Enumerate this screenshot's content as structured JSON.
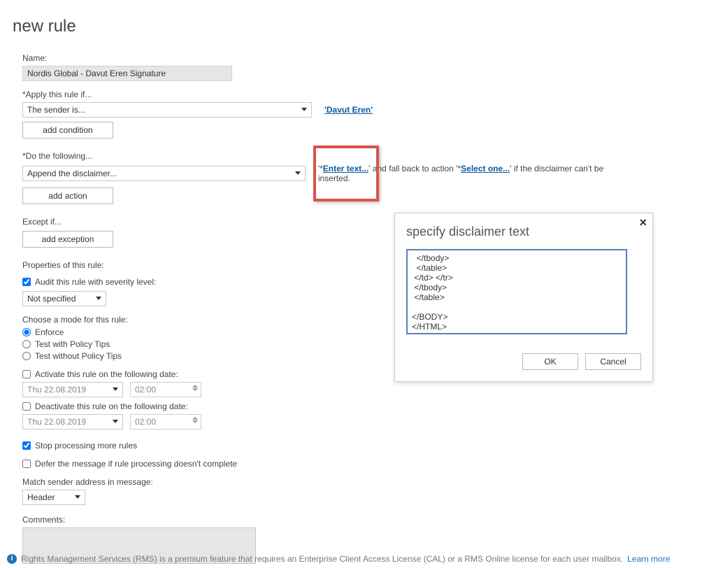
{
  "page": {
    "title": "new rule"
  },
  "form": {
    "name_label": "Name:",
    "name_value": "Nordis Global - Davut Eren Signature",
    "apply_label": "*Apply this rule if...",
    "apply_select": "The sender is...",
    "sender_link": "'Davut Eren'",
    "add_condition_btn": "add condition",
    "do_label": "*Do the following...",
    "do_select": "Append the disclaimer...",
    "enter_text_link": "Enter text...",
    "enter_text_prefix": "*",
    "action_text_mid": "' and fall back to action '",
    "select_one_prefix": "*",
    "select_one_link": "Select one...",
    "action_text_tail": " if the disclaimer can't be inserted.",
    "add_action_btn": "add action",
    "except_label": "Except if...",
    "add_exception_btn": "add exception",
    "props_title": "Properties of this rule:",
    "audit_label": "Audit this rule with severity level:",
    "audit_checked": true,
    "severity_select": "Not specified",
    "mode_label": "Choose a mode for this rule:",
    "mode_enforce": "Enforce",
    "mode_policytips": "Test with Policy Tips",
    "mode_noop": "Test without Policy Tips",
    "activate_label": "Activate this rule on the following date:",
    "activate_date": "Thu 22.08.2019",
    "activate_time": "02:00",
    "deactivate_label": "Deactivate this rule on the following date:",
    "deactivate_date": "Thu 22.08.2019",
    "deactivate_time": "02:00",
    "stop_label": "Stop processing more rules",
    "stop_checked": true,
    "defer_label": "Defer the message if rule processing doesn't complete",
    "match_label": "Match sender address in message:",
    "match_select": "Header",
    "comments_label": "Comments:"
  },
  "dialog": {
    "title": "specify disclaimer text",
    "text": "  </tbody>\n  </table>\n </td> </tr>\n </tbody>\n </table>\n\n</BODY>\n</HTML>",
    "ok": "OK",
    "cancel": "Cancel"
  },
  "footer": {
    "text": "Rights Management Services (RMS) is a premium feature that requires an Enterprise Client Access License (CAL) or a RMS Online license for each user mailbox. ",
    "learn_more": "Learn more"
  }
}
